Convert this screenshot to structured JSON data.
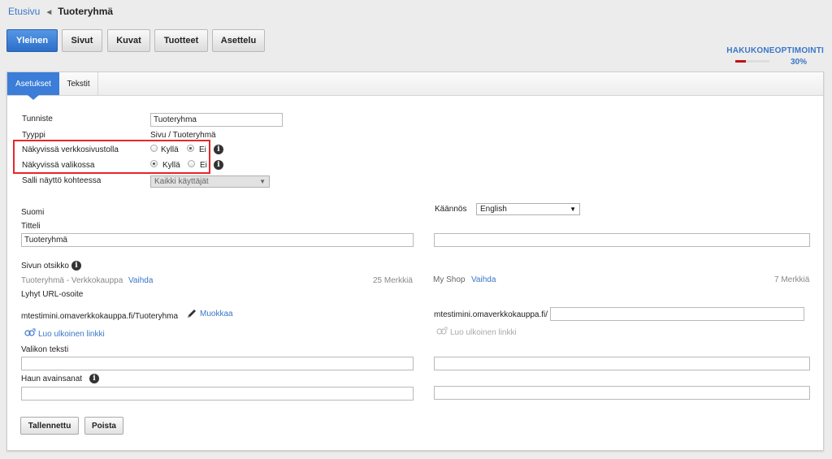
{
  "breadcrumb": {
    "home": "Etusivu",
    "current": "Tuoteryhmä"
  },
  "top_tabs": [
    {
      "label": "Yleinen",
      "active": true
    },
    {
      "label": "Sivut",
      "active": false
    },
    {
      "label": "Kuvat",
      "active": false
    },
    {
      "label": "Tuotteet",
      "active": false
    },
    {
      "label": "Asettelu",
      "active": false
    }
  ],
  "seo": {
    "title": "HAKUKONEOPTIMOINTI",
    "percent_label": "30%",
    "progress": 0.3
  },
  "sub_tabs": [
    {
      "label": "Asetukset",
      "active": true
    },
    {
      "label": "Tekstit",
      "active": false
    }
  ],
  "settings": {
    "identifier_label": "Tunniste",
    "identifier_value": "Tuoteryhma",
    "type_label": "Tyyppi",
    "type_value": "Sivu / Tuoteryhmä",
    "visible_store_label": "Näkyvissä verkkosivustolla",
    "visible_menu_label": "Näkyvissä valikossa",
    "yes": "Kyllä",
    "no": "Ei",
    "visible_store_selected": "no",
    "visible_menu_selected": "yes",
    "allow_view_label": "Salli näyttö kohteessa",
    "allow_view_value": "Kaikki käyttäjät"
  },
  "left": {
    "language_label": "Suomi",
    "title_label": "Titteli",
    "title_value": "Tuoteryhmä",
    "page_title_label": "Sivun otsikko",
    "page_title_value": "Tuoteryhmä - Verkkokauppa",
    "change_link": "Vaihda",
    "char_count": "25 Merkkiä",
    "short_url_label": "Lyhyt URL-osoite",
    "short_url": "mtestimini.omaverkkokauppa.fi/Tuoteryhma",
    "edit_link": "Muokkaa",
    "ext_link": "Luo ulkoinen linkki",
    "menu_text_label": "Valikon teksti",
    "keywords_label": "Haun avainsanat"
  },
  "right": {
    "translation_label": "Käännös",
    "translation_value": "English",
    "page_title_value": "My Shop",
    "change_link": "Vaihda",
    "char_count": "7 Merkkiä",
    "url_prefix": "mtestimini.omaverkkokauppa.fi/",
    "ext_link": "Luo ulkoinen linkki"
  },
  "actions": {
    "save": "Tallennettu",
    "delete": "Poista"
  },
  "colors": {
    "accent": "#3b7dd8",
    "link": "#3a76c8",
    "highlight": "#e8262a",
    "progress": "#c21010"
  }
}
